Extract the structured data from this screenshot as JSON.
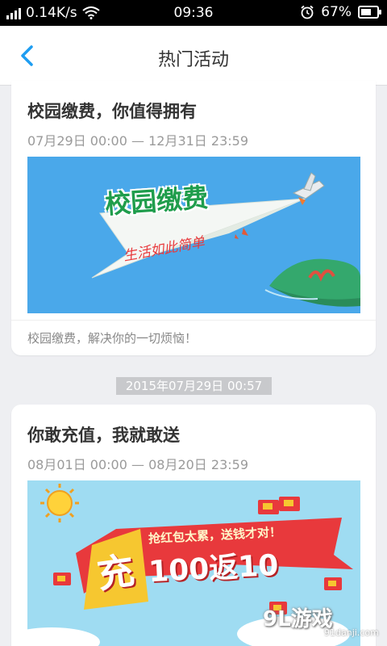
{
  "status_bar": {
    "network_speed": "0.14K/s",
    "time": "09:36",
    "battery_percent": "67%",
    "battery_level": 0.67
  },
  "header": {
    "title": "热门活动"
  },
  "activities": [
    {
      "title": "校园缴费，你值得拥有",
      "date_range": "07月29日 00:00 — 12月31日 23:59",
      "banner_text": "校园缴费",
      "banner_subtext": "生活如此简单",
      "description": "校园缴费，解决你的一切烦恼！"
    },
    {
      "title": "你敢充值，我就敢送",
      "date_range": "08月01日 00:00 — 08月20日 23:59",
      "banner_headline": "抢红包太累，送钱才对！",
      "banner_big": "充",
      "banner_offer": "100返10"
    }
  ],
  "timestamp": "2015年07月29日 00:57",
  "watermark": {
    "main": "9L游戏",
    "sub": "91danji.com"
  },
  "colors": {
    "accent": "#1e9df1",
    "banner1_sky": "#4aa8ea",
    "banner2_sky": "#8fd6f0",
    "promo_red": "#e8393c"
  }
}
